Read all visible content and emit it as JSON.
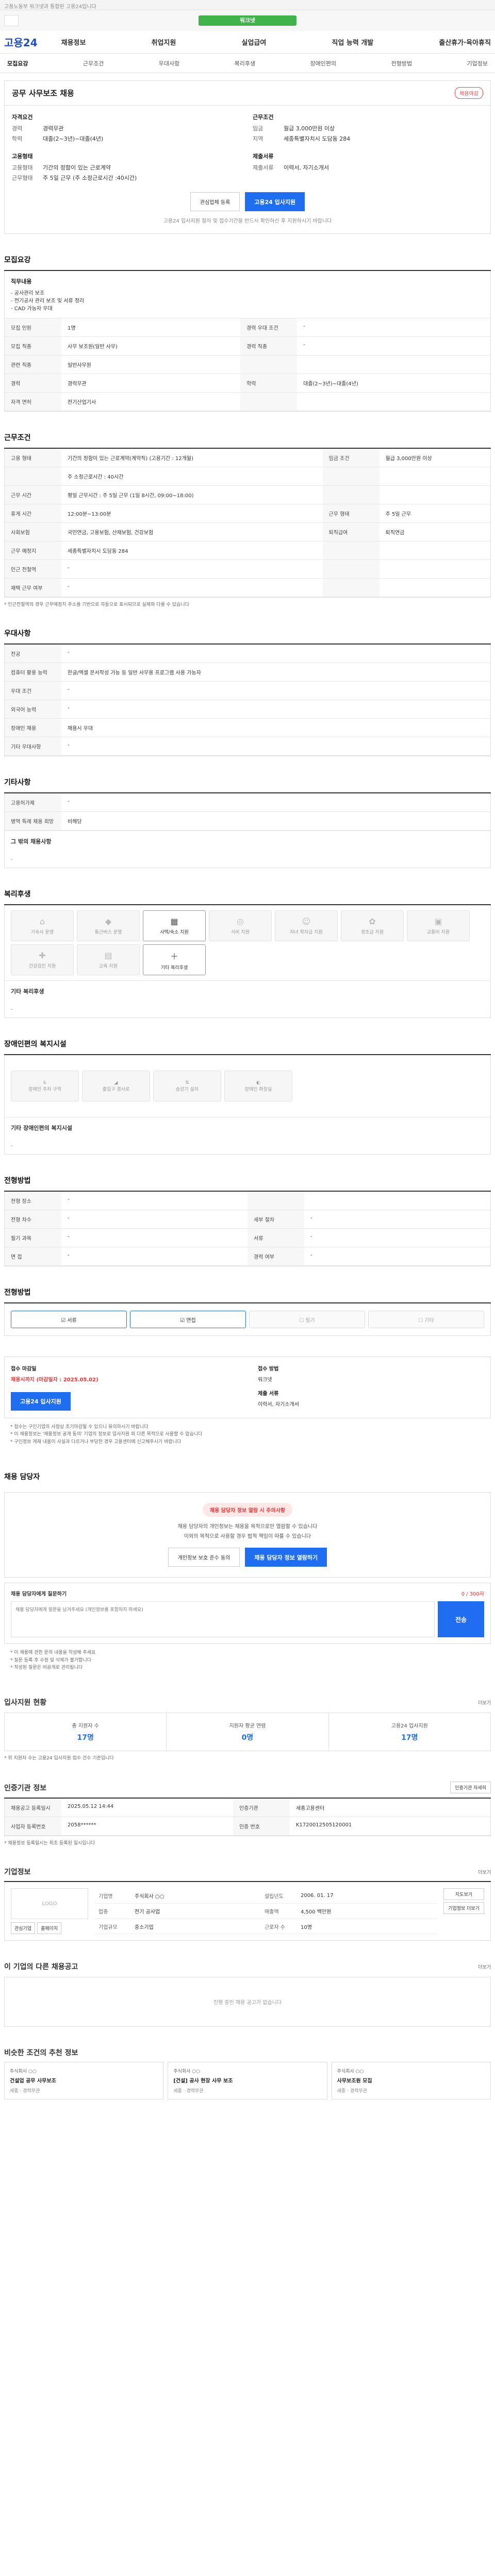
{
  "topbar": {
    "text": "고용노동부 워크넷과 통합된 고용24입니다"
  },
  "ribbon": {
    "label": "워크넷"
  },
  "gnb": {
    "logo": "고용24",
    "menu": [
      "채용정보",
      "취업지원",
      "실업급여",
      "직업 능력 개발",
      "출산휴가·육아휴직"
    ]
  },
  "tabs": [
    "모집요강",
    "근무조건",
    "우대사항",
    "복리후생",
    "장애인편의",
    "전형방법",
    "기업정보"
  ],
  "job": {
    "title": "공무 사무보조 채용",
    "badge": "채용마감",
    "left_title": "자격요건",
    "left_rows": [
      {
        "k": "경력",
        "v": "경력무관"
      },
      {
        "k": "학력",
        "v": "대졸(2~3년)~대졸(4년)"
      }
    ],
    "right_title": "근무조건",
    "right_rows": [
      {
        "k": "임금",
        "v": "월급 3,000만원 이상"
      },
      {
        "k": "지역",
        "v": "세종특별자치시 도담동 284"
      }
    ],
    "left2_title": "고용형태",
    "left2_rows": [
      {
        "k": "고용형태",
        "v": "기간의 정함이 있는 근로계약"
      },
      {
        "k": "근무형태",
        "v": "주 5일 근무 (주 소정근로시간 :40시간)"
      }
    ],
    "right2_title": "제출서류",
    "right2_rows": [
      {
        "k": "제출서류",
        "v": "이력서, 자기소개서"
      }
    ],
    "btn_share": "관심업체 등록",
    "btn_apply": "고용24 입사지원",
    "apply_note": "고용24 입사지원 절차 및 접수기간을 반드시 확인하신 후 지원하시기 바랍니다"
  },
  "recruit": {
    "title": "모집요강",
    "duties_label": "직무내용",
    "duties": [
      "공사관리 보조",
      "전기공사 관리 보조 및 서류 정리",
      "CAD 가능자 우대"
    ],
    "rows": [
      [
        "모집 인원",
        "1명",
        "경력 우대 조건",
        "-"
      ],
      [
        "모집 직종",
        "사무 보조원(일반 사무)",
        "경력 직종",
        "-"
      ],
      [
        "관련 직종",
        "일반사무원",
        "",
        ""
      ],
      [
        "경력",
        "경력무관",
        "학력",
        "대졸(2~3년)~대졸(4년)"
      ],
      [
        "자격 면허",
        "전기산업기사",
        "",
        ""
      ]
    ]
  },
  "work": {
    "title": "근무조건",
    "rows": [
      [
        "고용 형태",
        "기간의 정함이 있는 근로계약(계약직) (고용기간 : 12개월)",
        "임금 조건",
        "월급 3,000만원 이상"
      ],
      [
        "",
        "주 소정근로시간 : 40시간",
        "",
        ""
      ],
      [
        "근무 시간",
        "평일 근무시간 : 주 5일 근무 (1일 8시간, 09:00~18:00)",
        "",
        ""
      ],
      [
        "휴게 시간",
        "12:00분~13:00분",
        "근무 형태",
        "주 5일 근무"
      ],
      [
        "사회보험",
        "국민연금, 고용보험, 산재보험, 건강보험",
        "퇴직급여",
        "퇴직연금"
      ],
      [
        "근무 예정지",
        "세종특별자치시 도담동 284",
        "",
        ""
      ],
      [
        "인근 전철역",
        "-",
        "",
        ""
      ],
      [
        "재택 근무 여부",
        "-",
        "",
        ""
      ]
    ],
    "note": "* 인근전철역의 경우 근무예정지 주소를 기반으로 자동으로 표시되므로 실제와 다를 수 있습니다"
  },
  "pref": {
    "title": "우대사항",
    "rows": [
      [
        "전공",
        "-"
      ],
      [
        "컴퓨터 활용 능력",
        "한글/엑셀 문서작성 가능 등 일반 사무용 프로그램 사용 가능자"
      ],
      [
        "우대 조건",
        "-"
      ],
      [
        "외국어 능력",
        "-"
      ],
      [
        "장애인 채용",
        "채용시 우대"
      ],
      [
        "기타 우대사항",
        "-"
      ]
    ]
  },
  "other": {
    "title": "기타사항",
    "rows": [
      [
        "고용허가제",
        "-"
      ],
      [
        "병역 특례 채용 희망",
        "비해당"
      ]
    ],
    "etc_label": "그 밖의 채용사항",
    "etc": "-"
  },
  "welfare": {
    "title": "복리후생",
    "items": [
      {
        "icon": "house-icon",
        "label": "기숙사 운영",
        "on": false
      },
      {
        "icon": "car-icon",
        "label": "통근버스 운행",
        "on": false
      },
      {
        "icon": "building-icon",
        "label": "사택/숙소 지원",
        "on": true
      },
      {
        "icon": "meal-icon",
        "label": "식비 지원",
        "on": false
      },
      {
        "icon": "child-icon",
        "label": "자녀 학자금 지원",
        "on": false
      },
      {
        "icon": "gift-icon",
        "label": "경조금 지원",
        "on": false
      },
      {
        "icon": "bus-icon",
        "label": "교통비 지원",
        "on": false
      },
      {
        "icon": "health-icon",
        "label": "건강검진 지원",
        "on": false
      },
      {
        "icon": "book-icon",
        "label": "교육 지원",
        "on": false
      },
      {
        "icon": "plus-icon",
        "label": "기타 복리후생",
        "on": true
      }
    ],
    "other_label": "기타 복리후생",
    "other": "-"
  },
  "disab": {
    "title": "장애인편의 복지시설",
    "items": [
      {
        "icon": "wheelchair-icon",
        "label": "장애인 주차 구역"
      },
      {
        "icon": "ramp-icon",
        "label": "출입구 경사로"
      },
      {
        "icon": "elevator-icon",
        "label": "승강기 설치"
      },
      {
        "icon": "toilet-icon",
        "label": "장애인 화장실"
      }
    ],
    "other_label": "기타 장애인편의 복지시설",
    "other": "-"
  },
  "process": {
    "title": "전형방법",
    "rows": [
      [
        "전형 장소",
        "-",
        "",
        ""
      ],
      [
        "전형 차수",
        "-",
        "세부 절차",
        "-"
      ],
      [
        "필기 과목",
        "-",
        "서류",
        "-"
      ],
      [
        "면 접",
        "-",
        "경력 여부",
        "-"
      ]
    ]
  },
  "method": {
    "title": "전형방법",
    "items": [
      {
        "label": "서류",
        "on": true
      },
      {
        "label": "면접",
        "on": true
      },
      {
        "label": "필기",
        "on": false
      },
      {
        "label": "기타",
        "on": false
      }
    ]
  },
  "apply": {
    "title": "접수 마감일",
    "period_label": "채용시까지 (마감일자 : 2025.05.02)",
    "btn": "고용24 입사지원",
    "method_title": "접수 방법",
    "method": "워크넷",
    "docs_title": "제출 서류",
    "docs": "이력서, 자기소개서",
    "notes": [
      "* 접수는 구인기업의 사정상 조기마감될 수 있으니 유의하시기 바랍니다",
      "* 이 채용정보는 '채용정보 공개 동의' 기업의 정보로 입사지원 외 다른 목적으로 사용할 수 없습니다",
      "* 구인정보 게재 내용이 사실과 다르거나 부당한 경우 고용센터에 신고해주시기 바랍니다"
    ]
  },
  "manager": {
    "title": "채용 담당자",
    "alert": "채용 담당자 정보 열람 시 주의사항",
    "text1": "채용 담당자의 개인정보는 채용을 목적으로만 열람할 수 있습니다",
    "text2": "이외의 목적으로 사용할 경우 법적 책임이 따를 수 있습니다",
    "btn1": "개인정보 보호 준수 동의",
    "btn2": "채용 담당자 정보 열람하기"
  },
  "question": {
    "title": "채용 담당자에게 질문하기",
    "counter": "0 / 300자",
    "placeholder": "채용 담당자에게 질문을 남겨주세요 (개인정보를 포함하지 마세요)",
    "btn": "전송",
    "notes": [
      "* 이 채용에 관한 문의 내용을 작성해 주세요",
      "* 질문 등록 후 수정 및 삭제가 불가합니다",
      "* 작성된 질문은 비공개로 관리됩니다"
    ]
  },
  "stats": {
    "title": "입사지원 현황",
    "more": "더보기",
    "items": [
      {
        "label": "총 지원자 수",
        "value": "17명"
      },
      {
        "label": "지원자 평균 연령",
        "value": "0명"
      },
      {
        "label": "고용24 입사지원",
        "value": "17명"
      }
    ],
    "note": "* 위 지원자 수는 고용24 입사지원 접수 건수 기준입니다"
  },
  "cert": {
    "title": "인증기관 정보",
    "btn": "인증기관 자세히",
    "rows": [
      [
        "채용공고 등록일시",
        "2025.05.12 14:44",
        "인증기관",
        "세종고용센터"
      ],
      [
        "사업자 등록번호",
        "2058******",
        "인증 번호",
        "K1720012505120001"
      ]
    ],
    "note": "* 채용정보 등록일시는 최초 등록된 일시입니다"
  },
  "company": {
    "title": "기업정보",
    "more": "더보기",
    "logo": "LOGO",
    "btn_like": "관심기업",
    "btn_home": "홈페이지",
    "rows": [
      [
        "기업명",
        "주식회사 ○○",
        "설립년도",
        "2006. 01. 17"
      ],
      [
        "업종",
        "전기 공사업",
        "매출액",
        "4,500 백만원"
      ],
      [
        "기업규모",
        "중소기업",
        "근로자 수",
        "10명"
      ]
    ],
    "btn_map": "지도보기",
    "btn_view": "기업정보 더보기"
  },
  "same": {
    "title": "이 기업의 다른 채용공고",
    "more": "더보기",
    "empty": "진행 중인 채용 공고가 없습니다"
  },
  "similar": {
    "title": "비슷한 조건의 추천 정보",
    "cards": [
      {
        "company": "주식회사 ○○",
        "title": "건설업 공무 사무보조",
        "meta": "세종 · 경력무관"
      },
      {
        "company": "주식회사 ○○",
        "title": "[건설] 공사 현장 사무 보조",
        "meta": "세종 · 경력무관"
      },
      {
        "company": "주식회사 ○○",
        "title": "사무보조원 모집",
        "meta": "세종 · 경력무관"
      }
    ]
  }
}
